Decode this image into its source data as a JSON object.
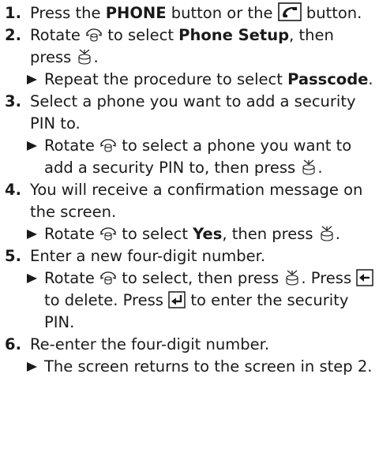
{
  "steps": [
    {
      "num": "1.",
      "t1": "Press the ",
      "b1": "PHONE",
      "t2": " button or the ",
      "t3": " button."
    },
    {
      "num": "2.",
      "t1": "Rotate ",
      "t2": " to select ",
      "b1": "Phone Setup",
      "t3": ", then press ",
      "t4": ".",
      "sub": {
        "t1": "Repeat the procedure to select ",
        "b1": "Passcode",
        "t2": "."
      }
    },
    {
      "num": "3.",
      "t1": "Select a phone you want to add a security PIN to.",
      "sub": {
        "t1": "Rotate ",
        "t2": " to select a phone you want to add a security PIN to, then press ",
        "t3": "."
      }
    },
    {
      "num": "4.",
      "t1": "You will receive a confirmation message on the screen.",
      "sub": {
        "t1": "Rotate ",
        "t2": " to select ",
        "b1": "Yes",
        "t3": ", then press ",
        "t4": "."
      }
    },
    {
      "num": "5.",
      "t1": "Enter a new four-digit number.",
      "sub": {
        "t1": "Rotate ",
        "t2": " to select, then press ",
        "t3": ". Press ",
        "t4": " to delete. Press ",
        "t5": " to enter the security PIN."
      }
    },
    {
      "num": "6.",
      "t1": "Re-enter the four-digit number.",
      "sub": {
        "t1": "The screen returns to the screen in step 2."
      }
    }
  ],
  "icons": {
    "phone": "phone-button-icon",
    "dial": "selector-knob-rotate-icon",
    "press": "selector-knob-press-icon",
    "back": "back-arrow-button-icon",
    "enter": "enter-button-icon"
  }
}
